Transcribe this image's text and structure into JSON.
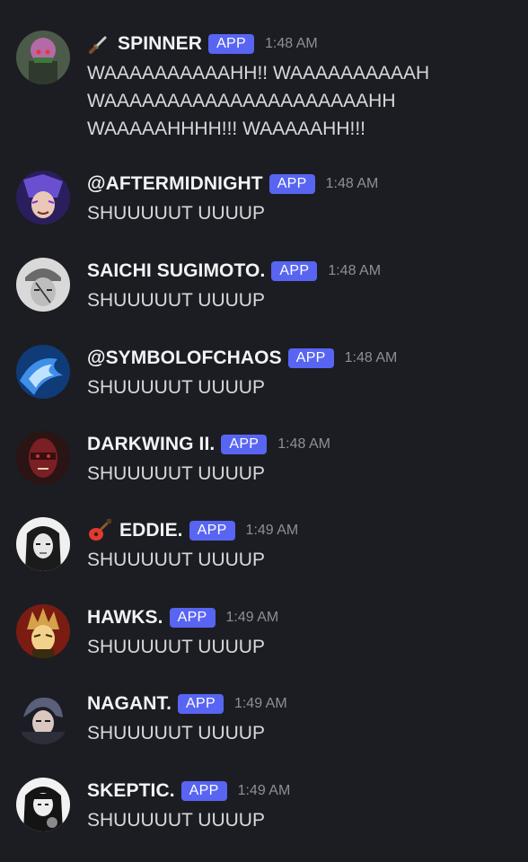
{
  "messages": [
    {
      "username": "SPINNER",
      "badge": "APP",
      "time": "1:48 AM",
      "emoji": "dagger-emoji",
      "lines": [
        "WAAAAAAAAAAHH!! WAAAAAAAAAAH",
        "WAAAAAAAAAAAAAAAAAAAAAHH",
        "WAAAAAHHHH!!! WAAAAAHH!!!"
      ],
      "avatar_colors": [
        "#4c5a4a",
        "#b46aa6",
        "#2f3a2c"
      ]
    },
    {
      "username": "@AFTERMIDNIGHT",
      "badge": "APP",
      "time": "1:48 AM",
      "lines": [
        "SHUUUUUT UUUUP"
      ],
      "avatar_colors": [
        "#2a1f5c",
        "#6b4fd1",
        "#e8c9b8"
      ]
    },
    {
      "username": "SAICHI SUGIMOTO.",
      "badge": "APP",
      "time": "1:48 AM",
      "lines": [
        "SHUUUUUT UUUUP"
      ],
      "avatar_colors": [
        "#d9d9d9",
        "#6a6a6a",
        "#2b2b2b"
      ]
    },
    {
      "username": "@SYMBOLOFCHAOS",
      "badge": "APP",
      "time": "1:48 AM",
      "lines": [
        "SHUUUUUT UUUUP"
      ],
      "avatar_colors": [
        "#0f3b78",
        "#3f8fe8",
        "#bfe3ff"
      ]
    },
    {
      "username": "DARKWING II.",
      "badge": "APP",
      "time": "1:48 AM",
      "lines": [
        "SHUUUUUT UUUUP"
      ],
      "avatar_colors": [
        "#2a1414",
        "#7a1f24",
        "#c23a3a"
      ]
    },
    {
      "username": "EDDIE.",
      "badge": "APP",
      "time": "1:49 AM",
      "emoji": "guitar-emoji",
      "lines": [
        "SHUUUUUT UUUUP"
      ],
      "avatar_colors": [
        "#f0f0f0",
        "#1b1b1b",
        "#777777"
      ]
    },
    {
      "username": "HAWKS.",
      "badge": "APP",
      "time": "1:49 AM",
      "lines": [
        "SHUUUUUT UUUUP"
      ],
      "avatar_colors": [
        "#7a1c12",
        "#d4a24a",
        "#f2d28a"
      ]
    },
    {
      "username": "NAGANT.",
      "badge": "APP",
      "time": "1:49 AM",
      "lines": [
        "SHUUUUUT UUUUP"
      ],
      "avatar_colors": [
        "#1c1c24",
        "#5a5f7a",
        "#d9c7c0"
      ]
    },
    {
      "username": "SKEPTIC.",
      "badge": "APP",
      "time": "1:49 AM",
      "lines": [
        "SHUUUUUT UUUUP"
      ],
      "avatar_colors": [
        "#f2f2f2",
        "#141414",
        "#8a8a8a"
      ]
    }
  ],
  "colors": {
    "background": "#1c1d22",
    "app_badge": "#5865f2",
    "username": "#f2f3f5",
    "timestamp": "#8d8f98"
  }
}
